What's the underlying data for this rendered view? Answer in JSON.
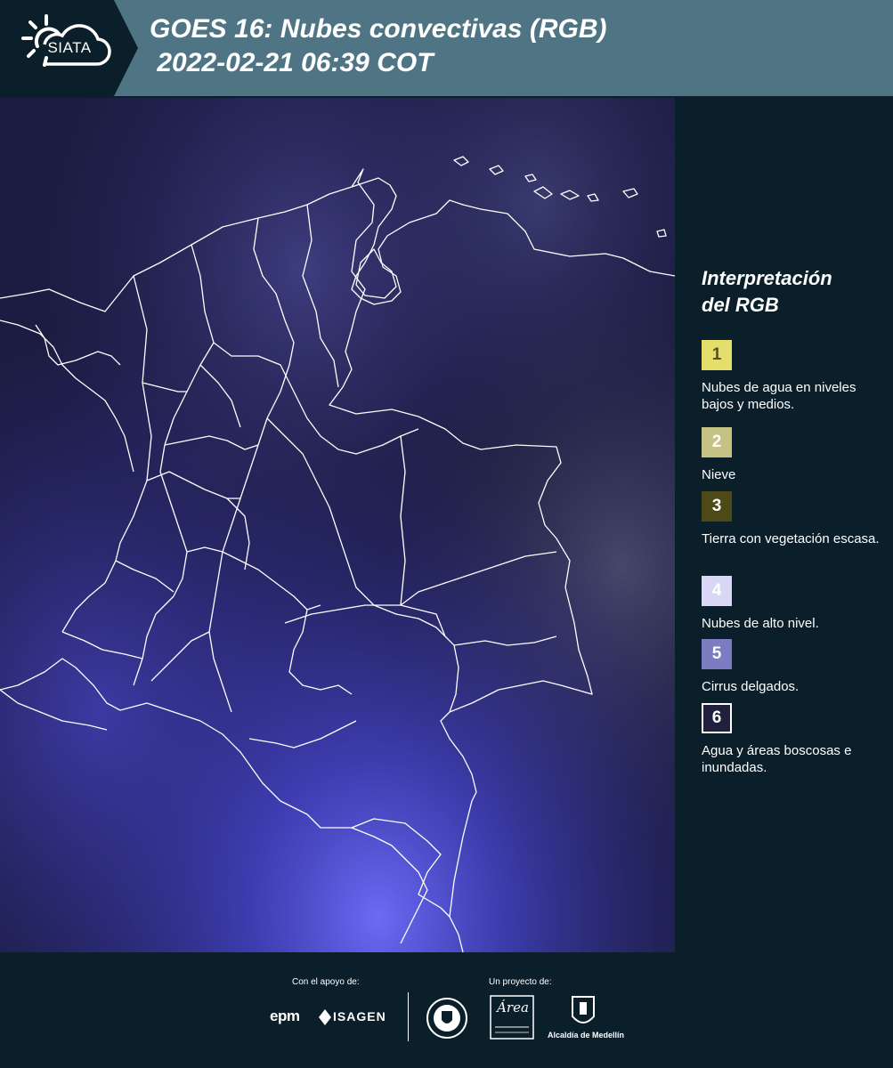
{
  "header": {
    "logo_text": "SIATA",
    "title_line1": "GOES 16: Nubes convectivas (RGB)",
    "title_line2": " 2022-02-21 06:39 COT"
  },
  "legend": {
    "title_line1": "Interpretación",
    "title_line2": "del RGB",
    "items": [
      {
        "number": "1",
        "label": "Nubes de agua en niveles bajos y medios.",
        "color": "#e3df6a",
        "text_color": "#55531c"
      },
      {
        "number": "2",
        "label": "Nieve",
        "color": "#c5c283",
        "text_color": "#ffffff"
      },
      {
        "number": "3",
        "label": "Tierra con vegetación escasa.",
        "color": "#4d4a18",
        "text_color": "#ffffff"
      },
      {
        "number": "4",
        "label": "Nubes de alto nivel.",
        "color": "#d8d8f6",
        "text_color": "#ffffff"
      },
      {
        "number": "5",
        "label": "Cirrus delgados.",
        "color": "#7c7cc0",
        "text_color": "#ffffff"
      },
      {
        "number": "6",
        "label": "Agua y áreas boscosas e inundadas.",
        "color": "#201f3e",
        "text_color": "#ffffff"
      }
    ]
  },
  "map": {
    "background_color": "#1c1c42",
    "border_color": "#ffffff"
  },
  "footer": {
    "support_label": "Con el apoyo de:",
    "project_label": "Un proyecto de:",
    "epm_label": "epm",
    "isagen_label": "ISAGEN",
    "area_label": "Área",
    "alcaldia_label": "Alcaldía de Medellín"
  }
}
